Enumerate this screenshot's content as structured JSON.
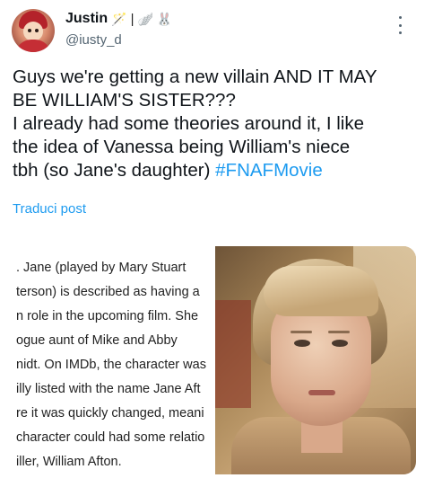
{
  "author": {
    "display_name": "Justin",
    "decorations": [
      "🪄",
      "|",
      "🪽",
      "🐰"
    ],
    "handle": "@iusty_d",
    "avatar_icon": "avatar-icon"
  },
  "tweet": {
    "lines": [
      "Guys we're getting a new villain AND IT MAY",
      "BE WILLIAM'S SISTER???",
      "I already had some theories around it, I like",
      "the idea of Vanessa being William's niece"
    ],
    "last_line": "tbh (so Jane's daughter) ",
    "hashtag": "#FNAFMovie"
  },
  "translate_label": "Traduci post",
  "media": {
    "article_lines": [
      ". Jane (played by Mary Stuart",
      "terson) is described as having a",
      "n role in the upcoming film. She",
      "ogue aunt of Mike and Abby",
      "nidt. On IMDb, the character was",
      "illy listed with the name Jane Aft",
      "re it was quickly changed, meani",
      "character could had some relatio",
      "iller, William Afton."
    ],
    "photo_icon": "portrait-photo"
  },
  "colors": {
    "link": "#1d9bf0",
    "secondary_text": "#536471",
    "primary_text": "#0f1419"
  }
}
